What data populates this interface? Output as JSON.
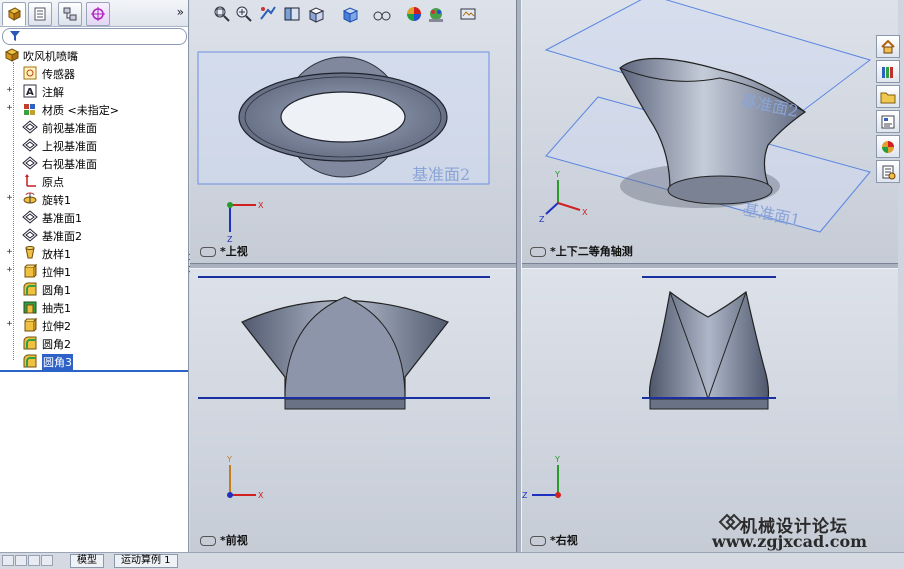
{
  "left_panel": {
    "collapse_label": "»",
    "tree": [
      {
        "label": "吹风机喷嘴",
        "icon": "part-icon",
        "expander": "",
        "root": true
      },
      {
        "label": "传感器",
        "icon": "sensor-icon",
        "expander": ""
      },
      {
        "label": "注解",
        "icon": "annotation-icon",
        "expander": "+"
      },
      {
        "label": "材质 <未指定>",
        "icon": "material-icon",
        "expander": "+"
      },
      {
        "label": "前视基准面",
        "icon": "plane-icon",
        "expander": ""
      },
      {
        "label": "上视基准面",
        "icon": "plane-icon",
        "expander": ""
      },
      {
        "label": "右视基准面",
        "icon": "plane-icon",
        "expander": ""
      },
      {
        "label": "原点",
        "icon": "origin-icon",
        "expander": ""
      },
      {
        "label": "旋转1",
        "icon": "revolve-icon",
        "expander": "+"
      },
      {
        "label": "基准面1",
        "icon": "plane-icon",
        "expander": ""
      },
      {
        "label": "基准面2",
        "icon": "plane-icon",
        "expander": ""
      },
      {
        "label": "放样1",
        "icon": "loft-icon",
        "expander": "+"
      },
      {
        "label": "拉伸1",
        "icon": "extrude-icon",
        "expander": "+"
      },
      {
        "label": "圆角1",
        "icon": "fillet-icon",
        "expander": ""
      },
      {
        "label": "抽壳1",
        "icon": "shell-icon",
        "expander": ""
      },
      {
        "label": "拉伸2",
        "icon": "extrude-icon",
        "expander": "+"
      },
      {
        "label": "圆角2",
        "icon": "fillet-icon",
        "expander": ""
      },
      {
        "label": "圆角3",
        "icon": "fillet-icon",
        "expander": "",
        "selected": true
      }
    ]
  },
  "bottom_tabs": {
    "model": "模型",
    "motion": "运动算例 1"
  },
  "viewports": {
    "top": {
      "title": "*上视",
      "plane_label": "基准面2"
    },
    "iso": {
      "title": "*上下二等角轴测",
      "plane_label_1": "基准面2",
      "plane_label_2": "基准面1"
    },
    "front": {
      "title": "*前视"
    },
    "right": {
      "title": "*右视"
    }
  },
  "axes": {
    "x": "X",
    "y": "Y",
    "z": "Z"
  },
  "watermark": {
    "line1": "机械设计论坛",
    "line2": "www.zgjxcad.com"
  },
  "colors": {
    "selection": "#2f62c6",
    "plane": "#5b86e0",
    "sketch_line": "#1a2fa0",
    "axis_x": "#d02020",
    "axis_y": "#2a9a2a",
    "axis_z": "#2030c0"
  }
}
